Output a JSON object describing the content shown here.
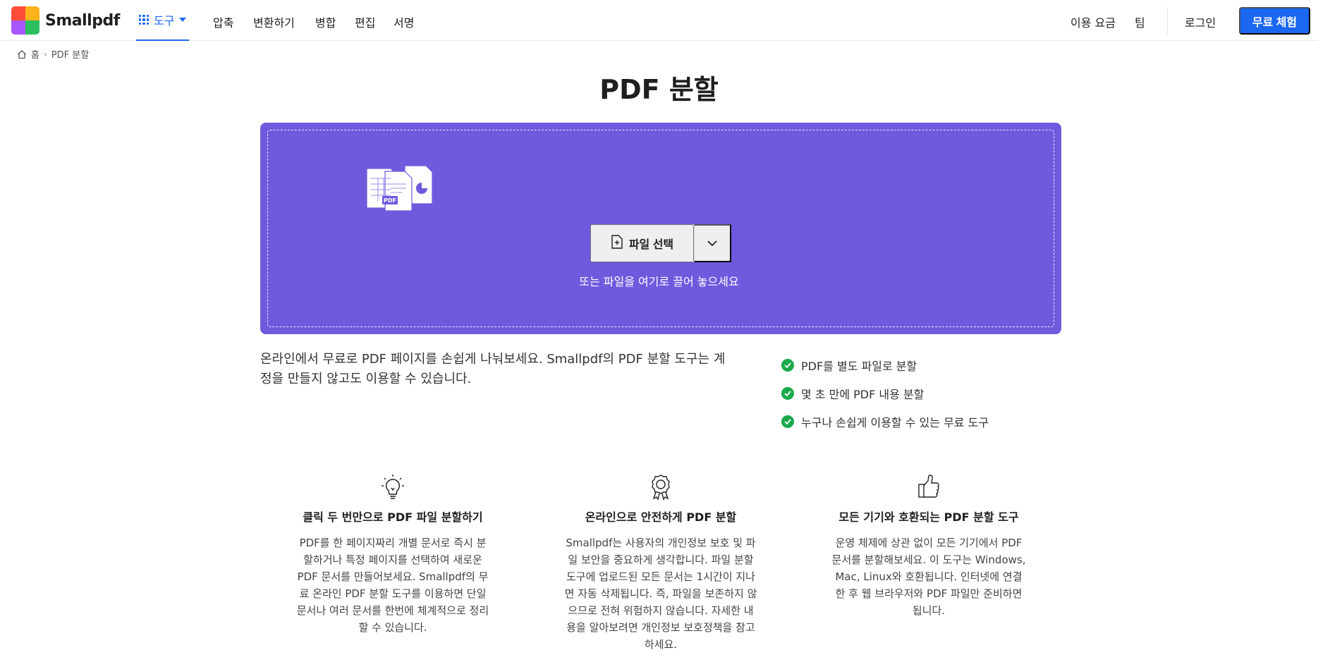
{
  "header": {
    "logo_text": "Smallpdf",
    "tools_label": "도구",
    "nav": [
      "압축",
      "변환하기",
      "병합",
      "편집",
      "서명"
    ],
    "pricing": "이용 요금",
    "team": "팀",
    "login": "로그인",
    "cta": "무료 체험"
  },
  "breadcrumb": {
    "home": "홈",
    "current": "PDF 분할"
  },
  "page_title": "PDF 분할",
  "dropzone": {
    "choose_file": "파일 선택",
    "hint": "또는 파일을 여기로 끌어 놓으세요",
    "illustration_badge": "PDF"
  },
  "intro": "온라인에서 무료로 PDF 페이지를 손쉽게 나눠보세요. Smallpdf의 PDF 분할 도구는 계정을 만들지 않고도 이용할 수 있습니다.",
  "features": [
    "PDF를 별도 파일로 분할",
    "몇 초 만에 PDF 내용 분할",
    "누구나 손쉽게 이용할 수 있는 무료 도구"
  ],
  "benefits": [
    {
      "icon": "lightbulb-icon",
      "title": "클릭 두 번만으로 PDF 파일 분할하기",
      "text": "PDF를 한 페이지짜리 개별 문서로 즉시 분할하거나 특정 페이지를 선택하여 새로운 PDF 문서를 만들어보세요. Smallpdf의 무료 온라인 PDF 분할 도구를 이용하면 단일 문서나 여러 문서를 한번에 체계적으로 정리할 수 있습니다."
    },
    {
      "icon": "award-ribbon-icon",
      "title": "온라인으로 안전하게 PDF 분할",
      "text": "Smallpdf는 사용자의 개인정보 보호 및 파일 보안을 중요하게 생각합니다. 파일 분할 도구에 업로드된 모든 문서는 1시간이 지나면 자동 삭제됩니다. 즉, 파일을 보존하지 않으므로 전혀 위험하지 않습니다. 자세한 내용을 알아보려면 개인정보 보호정책을 참고하세요."
    },
    {
      "icon": "thumbs-up-icon",
      "title": "모든 기기와 호환되는 PDF 분할 도구",
      "text": "운영 체제에 상관 없이 모든 기기에서 PDF 문서를 분할해보세요. 이 도구는 Windows, Mac, Linux와 호환됩니다. 인터넷에 연결한 후 웹 브라우저와 PDF 파일만 준비하면 됩니다."
    }
  ],
  "colors": {
    "brand_blue": "#1a67f0",
    "dropzone_purple": "#6f5ade",
    "check_green": "#1ba94c"
  }
}
